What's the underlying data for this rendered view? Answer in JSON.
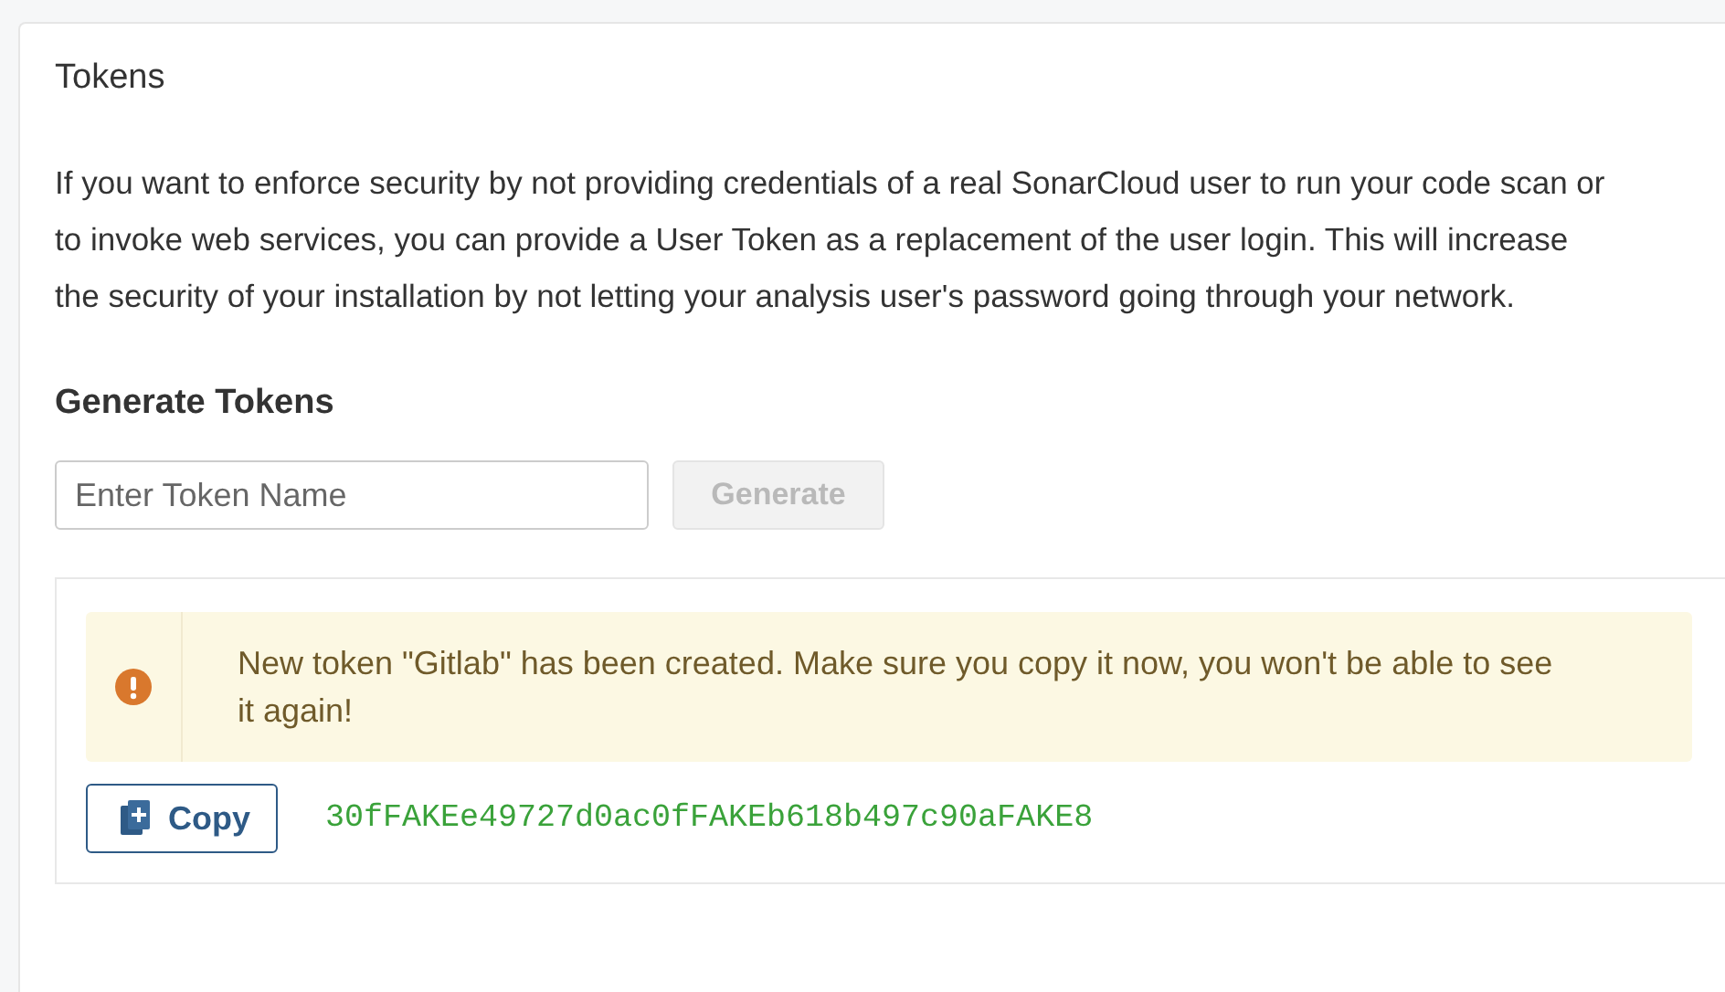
{
  "section": {
    "title": "Tokens",
    "description": "If you want to enforce security by not providing credentials of a real SonarCloud user to run your code scan or to invoke web services, you can provide a User Token as a replacement of the user login. This will increase the security of your installation by not letting your analysis user's password going through your network."
  },
  "generate": {
    "heading": "Generate Tokens",
    "field": {
      "placeholder": "Enter Token Name"
    },
    "button": {
      "label": "Generate",
      "disabled": true
    }
  },
  "result": {
    "alert": {
      "kind": "warning",
      "message": "New token \"Gitlab\" has been created. Make sure you copy it now, you won't be able to see it again!"
    },
    "copy_button": "Copy",
    "token": "30fFAKEe49727d0ac0fFAKEb618b497c90aFAKE8"
  }
}
